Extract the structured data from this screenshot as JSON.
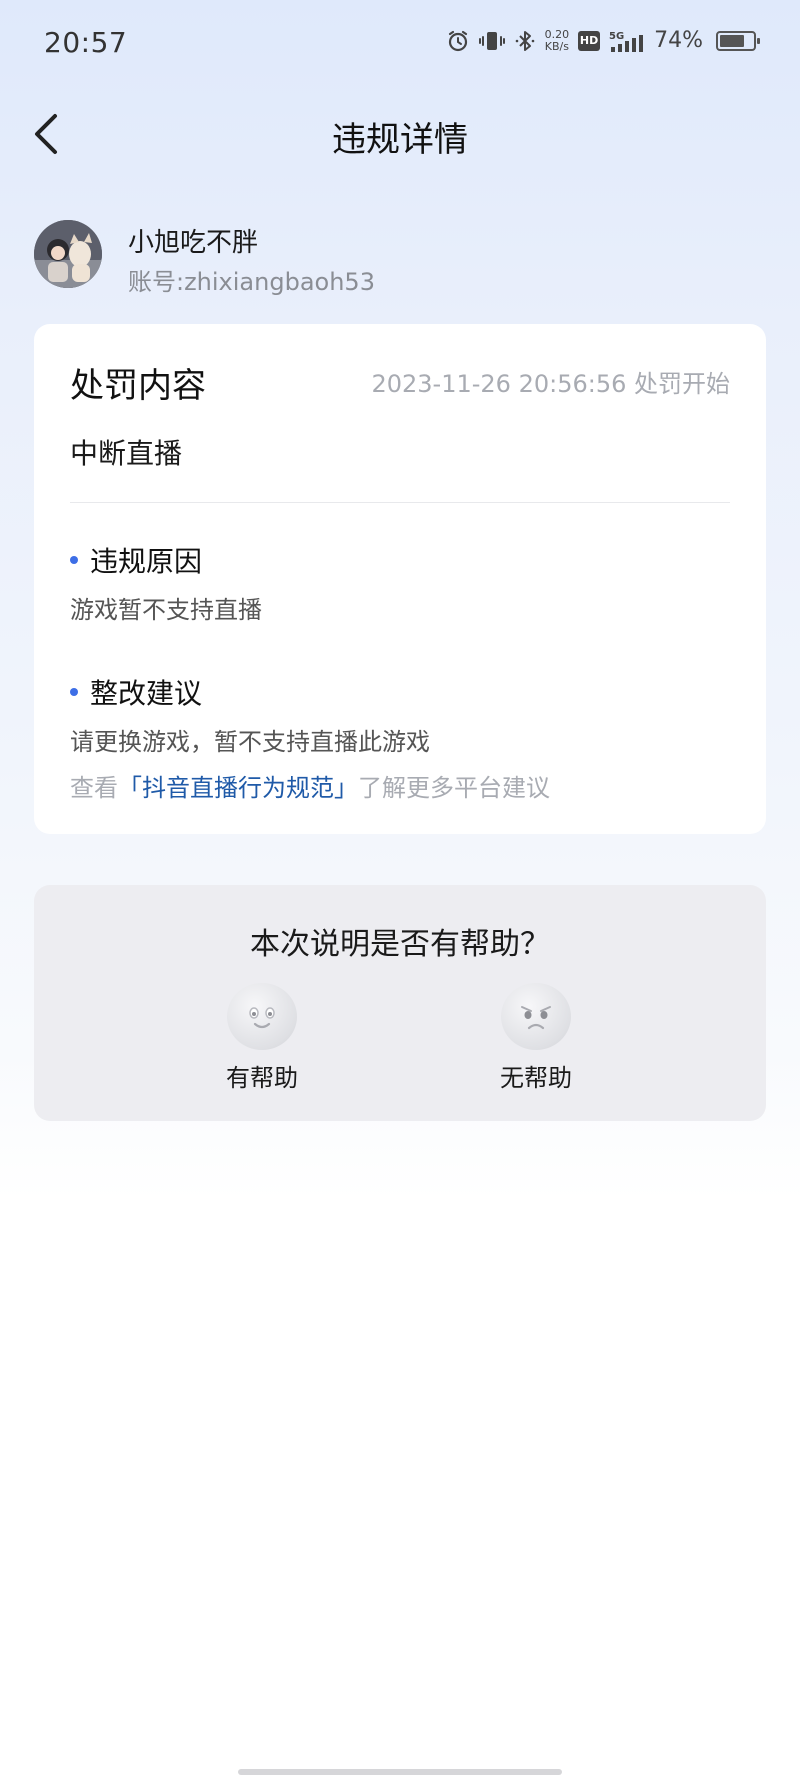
{
  "status_bar": {
    "time": "20:57",
    "net_speed_value": "0.20",
    "net_speed_unit": "KB/s",
    "hd_label": "HD",
    "network_label": "5G",
    "battery_percent": "74%",
    "battery_level": 0.74
  },
  "nav": {
    "title": "违规详情"
  },
  "user": {
    "name": "小旭吃不胖",
    "account": "账号:zhixiangbaoh53"
  },
  "penalty": {
    "title": "处罚内容",
    "time": "2023-11-26 20:56:56 处罚开始",
    "value": "中断直播",
    "reason_heading": "违规原因",
    "reason_text": "游戏暂不支持直播",
    "suggestion_heading": "整改建议",
    "suggestion_text": "请更换游戏，暂不支持直播此游戏",
    "link_prefix": "查看",
    "link_text": "「抖音直播行为规范」",
    "link_suffix": "了解更多平台建议"
  },
  "feedback": {
    "question": "本次说明是否有帮助？",
    "helpful_label": "有帮助",
    "unhelpful_label": "无帮助"
  },
  "colors": {
    "accent_blue": "#3d6ee6",
    "link_blue": "#1f5aa8"
  }
}
